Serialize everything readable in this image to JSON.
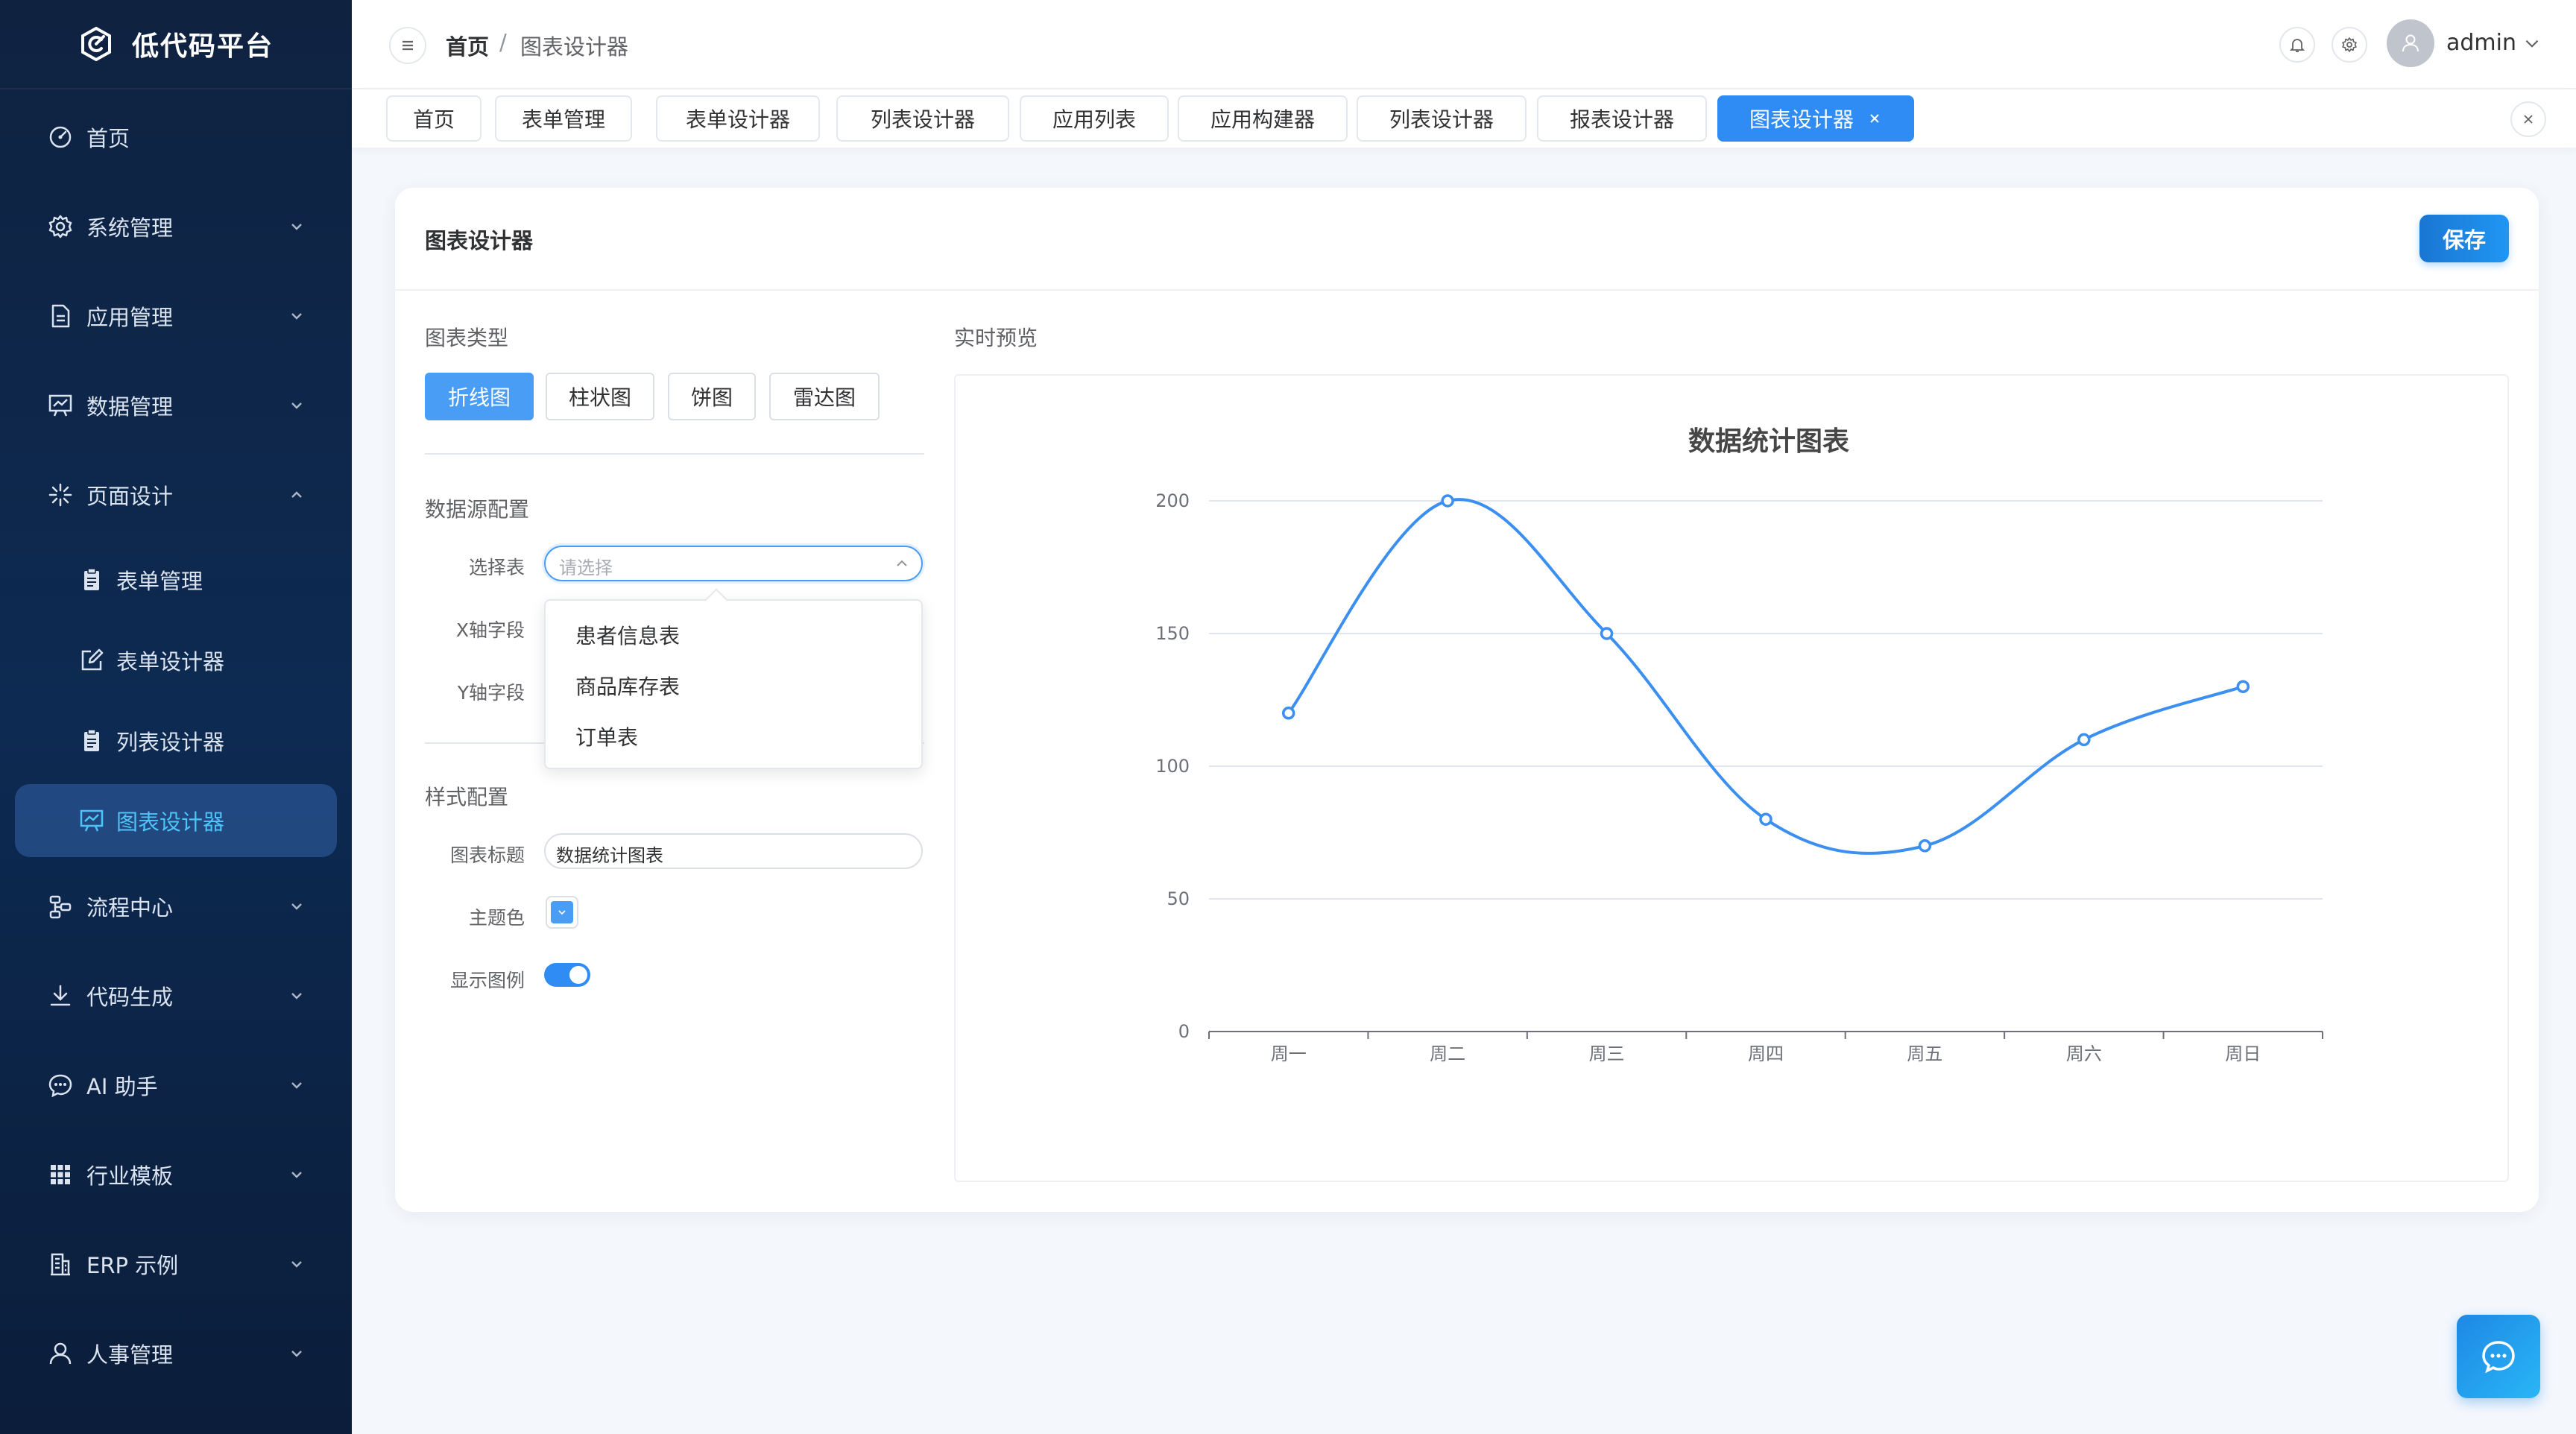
{
  "app": {
    "title": "低代码平台"
  },
  "sidebar": {
    "items": [
      {
        "label": "首页",
        "icon": "dashboard-icon"
      },
      {
        "label": "系统管理",
        "icon": "gear-icon"
      },
      {
        "label": "应用管理",
        "icon": "document-icon"
      },
      {
        "label": "数据管理",
        "icon": "chart-board-icon"
      },
      {
        "label": "页面设计",
        "icon": "sparkle-icon"
      },
      {
        "label": "表单管理",
        "icon": "clipboard-icon"
      },
      {
        "label": "表单设计器",
        "icon": "edit-icon"
      },
      {
        "label": "列表设计器",
        "icon": "clipboard-icon"
      },
      {
        "label": "图表设计器",
        "icon": "chart-board-icon"
      },
      {
        "label": "流程中心",
        "icon": "flow-icon"
      },
      {
        "label": "代码生成",
        "icon": "download-icon"
      },
      {
        "label": "AI 助手",
        "icon": "chat-icon"
      },
      {
        "label": "行业模板",
        "icon": "grid-icon"
      },
      {
        "label": "ERP 示例",
        "icon": "building-icon"
      },
      {
        "label": "人事管理",
        "icon": "user-icon"
      }
    ]
  },
  "header": {
    "breadcrumb": [
      "首页",
      "图表设计器"
    ],
    "breadcrumb_sep": "/",
    "username": "admin"
  },
  "tabs": [
    "首页",
    "表单管理",
    "表单设计器",
    "列表设计器",
    "应用列表",
    "应用构建器",
    "列表设计器",
    "报表设计器",
    "图表设计器"
  ],
  "card": {
    "title": "图表设计器",
    "save_label": "保存"
  },
  "config": {
    "chart_type_label": "图表类型",
    "chart_types": [
      "折线图",
      "柱状图",
      "饼图",
      "雷达图"
    ],
    "datasource_label": "数据源配置",
    "select_table_label": "选择表",
    "select_placeholder": "请选择",
    "x_field_label": "X轴字段",
    "y_field_label": "Y轴字段",
    "table_options": [
      "患者信息表",
      "商品库存表",
      "订单表"
    ],
    "style_label": "样式配置",
    "chart_title_label": "图表标题",
    "chart_title_value": "数据统计图表",
    "theme_color_label": "主题色",
    "theme_color": "#4a9df5",
    "show_legend_label": "显示图例",
    "show_legend": true
  },
  "preview": {
    "label": "实时预览"
  },
  "chart_data": {
    "type": "line",
    "title": "数据统计图表",
    "categories": [
      "周一",
      "周二",
      "周三",
      "周四",
      "周五",
      "周六",
      "周日"
    ],
    "series": [
      {
        "values": [
          120,
          200,
          150,
          80,
          70,
          110,
          130
        ]
      }
    ],
    "ylim": [
      0,
      200
    ],
    "yticks": [
      0,
      50,
      100,
      150,
      200
    ],
    "smooth": true,
    "grid": true,
    "color": "#3b8ff0"
  }
}
